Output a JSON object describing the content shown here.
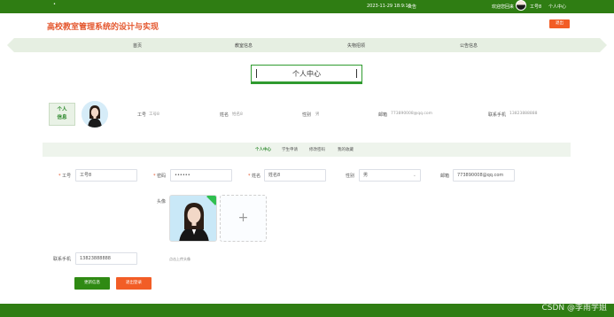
{
  "topbar": {
    "dot": "•",
    "datetime": "2023-11-29 18:9:16",
    "notice": "公告",
    "welcome": "欢迎您回来",
    "username": "工号8",
    "personal_center": "个人中心"
  },
  "header": {
    "site_title": "高校教室管理系统的设计与实现",
    "exit_label": "退出"
  },
  "nav": {
    "items": [
      "首页",
      "教室信息",
      "失物招领",
      "公告信息"
    ]
  },
  "page_title": "个人中心",
  "profile": {
    "label_line1": "个人",
    "label_line2": "信息",
    "staff_no_label": "工号",
    "staff_no": "工号8",
    "name_label": "姓名",
    "name": "姓名8",
    "gender_label": "性别",
    "gender": "男",
    "email_label": "邮箱",
    "email": "773890008@qq.com",
    "phone_label": "联系手机",
    "phone": "13823888888"
  },
  "tabs": [
    {
      "label": "个人中心",
      "active": true
    },
    {
      "label": "学生申请",
      "active": false
    },
    {
      "label": "修改密码",
      "active": false
    },
    {
      "label": "我的收藏",
      "active": false
    }
  ],
  "form": {
    "staff_no_label": "工号",
    "staff_no_value": "工号8",
    "password_label": "密码",
    "password_value": "••••••",
    "name_label": "姓名",
    "name_value": "姓名8",
    "gender_label": "性别",
    "gender_value": "男",
    "email_label": "邮箱",
    "email_value": "773890008@qq.com",
    "avatar_label": "头像",
    "upload_plus": "+",
    "upload_hint": "点击上传头像",
    "phone_label": "联系手机",
    "phone_value": "13823888888",
    "update_button": "更新信息",
    "logout_button": "退出登录",
    "required_mark": "*"
  },
  "watermark": "CSDN @李雨学姐",
  "colors": {
    "primary_green": "#2f7d13",
    "accent_orange": "#f25d26",
    "title_red": "#e4572e"
  },
  "icons": {
    "chevron": "chevron-down-icon",
    "check": "check-badge-icon"
  }
}
